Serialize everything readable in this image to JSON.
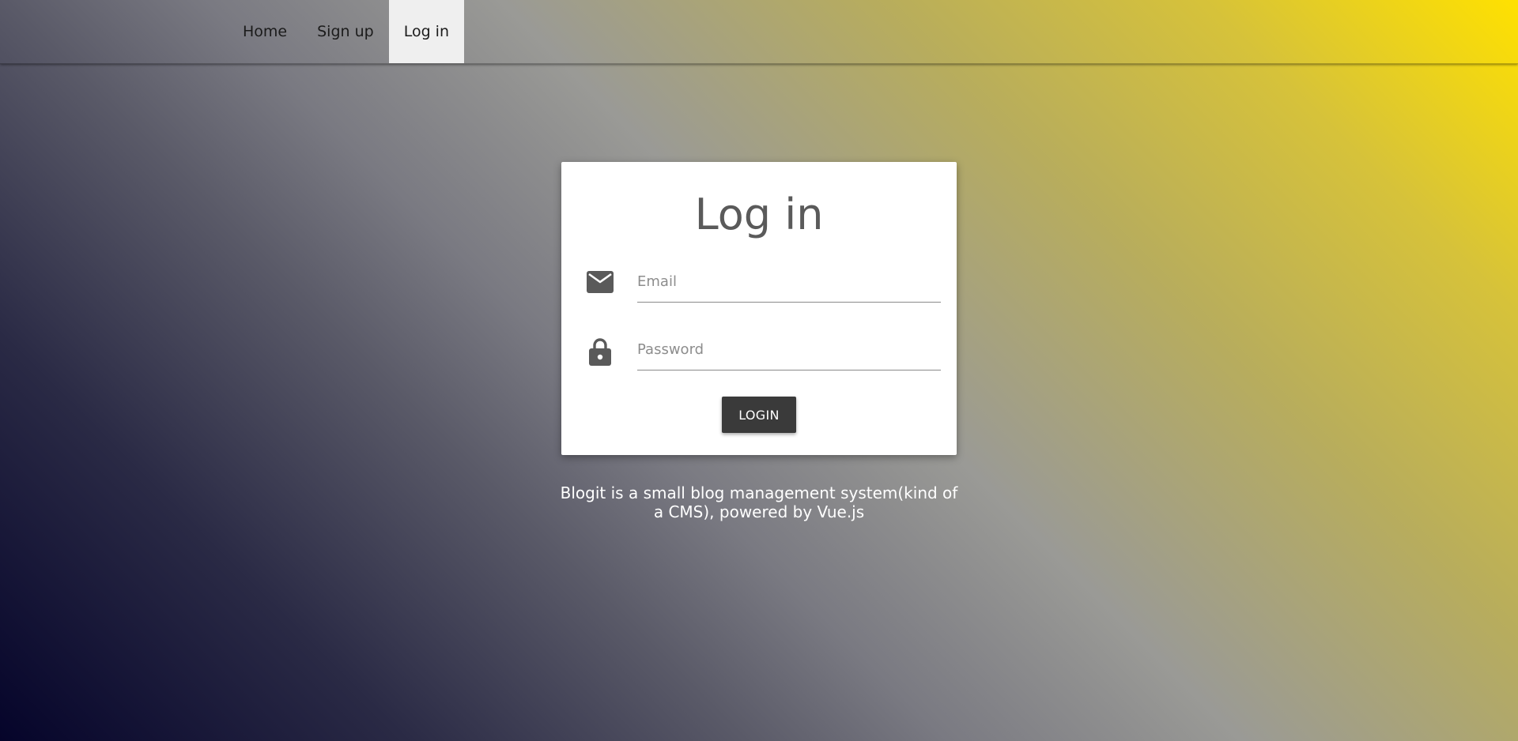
{
  "nav": {
    "items": [
      {
        "label": "Home",
        "active": false
      },
      {
        "label": "Sign up",
        "active": false
      },
      {
        "label": "Log in",
        "active": true
      }
    ]
  },
  "login_card": {
    "title": "Log in",
    "email": {
      "placeholder": "Email",
      "value": "",
      "icon": "mail-icon"
    },
    "password": {
      "placeholder": "Password",
      "value": "",
      "icon": "lock-icon"
    },
    "submit_label": "LOGIN"
  },
  "footer": {
    "tagline": "Blogit is a small blog management system(kind of a CMS), powered by Vue.js"
  },
  "colors": {
    "gradient_start": "#05042a",
    "gradient_end": "#ffe100",
    "button_bg": "#3a3a3a",
    "active_nav_bg": "#efefef"
  }
}
